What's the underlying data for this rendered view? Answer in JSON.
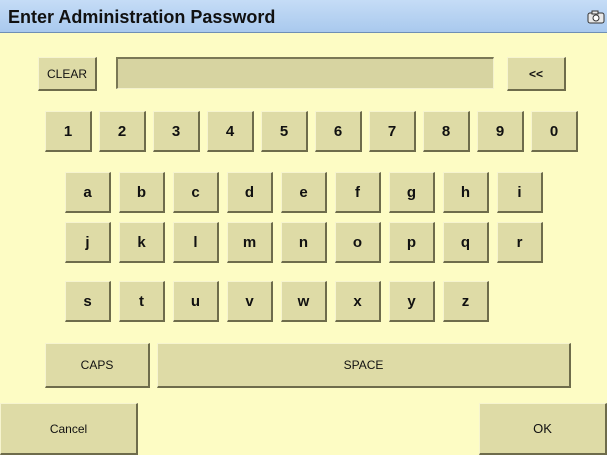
{
  "dialog": {
    "title": "Enter Administration Password",
    "title_icon": "camera-icon"
  },
  "password_field": {
    "value": ""
  },
  "controls": {
    "clear_label": "CLEAR",
    "backspace_label": "<<",
    "caps_label": "CAPS",
    "space_label": "SPACE",
    "cancel_label": "Cancel",
    "ok_label": "OK"
  },
  "keys": {
    "digits": [
      "1",
      "2",
      "3",
      "4",
      "5",
      "6",
      "7",
      "8",
      "9",
      "0"
    ],
    "row1": [
      "a",
      "b",
      "c",
      "d",
      "e",
      "f",
      "g",
      "h",
      "i"
    ],
    "row2": [
      "j",
      "k",
      "l",
      "m",
      "n",
      "o",
      "p",
      "q",
      "r"
    ],
    "row3": [
      "s",
      "t",
      "u",
      "v",
      "w",
      "x",
      "y",
      "z"
    ]
  },
  "colors": {
    "background": "#fdfcc4",
    "key_face": "#dedba6",
    "title_bar": "#b7d2f2"
  }
}
